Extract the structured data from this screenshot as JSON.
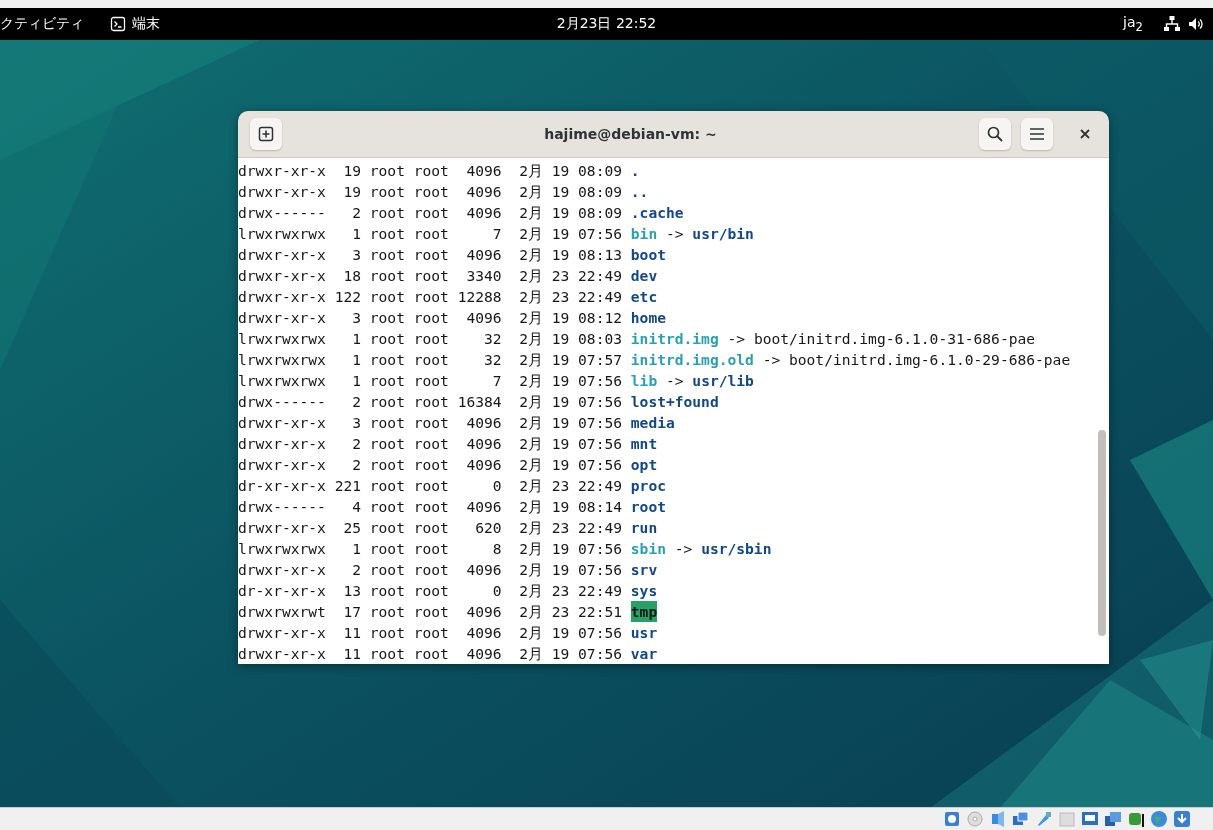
{
  "top_bar": {
    "activities": "クティビティ",
    "app_menu": "端末",
    "clock": "2月23日 22:52",
    "input_method": "ja$_{2}$"
  },
  "window": {
    "title": "hajime@debian-vm: ~"
  },
  "terminal": {
    "lines": [
      {
        "info": "drwxr-xr-x  19 root root  4096  2月 19 08:09",
        "name": ".",
        "kind": "dir"
      },
      {
        "info": "drwxr-xr-x  19 root root  4096  2月 19 08:09",
        "name": "..",
        "kind": "dir"
      },
      {
        "info": "drwx------   2 root root  4096  2月 19 08:09",
        "name": ".cache",
        "kind": "dir"
      },
      {
        "info": "lrwxrwxrwx   1 root root     7  2月 19 07:56",
        "name": "bin",
        "kind": "link",
        "arrow": "->",
        "target": {
          "text": "usr/bin",
          "kind": "dir"
        }
      },
      {
        "info": "drwxr-xr-x   3 root root  4096  2月 19 08:13",
        "name": "boot",
        "kind": "dir"
      },
      {
        "info": "drwxr-xr-x  18 root root  3340  2月 23 22:49",
        "name": "dev",
        "kind": "dir"
      },
      {
        "info": "drwxr-xr-x 122 root root 12288  2月 23 22:49",
        "name": "etc",
        "kind": "dir"
      },
      {
        "info": "drwxr-xr-x   3 root root  4096  2月 19 08:12",
        "name": "home",
        "kind": "dir"
      },
      {
        "info": "lrwxrwxrwx   1 root root    32  2月 19 08:03",
        "name": "initrd.img",
        "kind": "link",
        "arrow": "->",
        "target": {
          "text": "boot/initrd.img-6.1.0-31-686-pae",
          "kind": "file"
        }
      },
      {
        "info": "lrwxrwxrwx   1 root root    32  2月 19 07:57",
        "name": "initrd.img.old",
        "kind": "link",
        "arrow": "->",
        "target": {
          "text": "boot/initrd.img-6.1.0-29-686-pae",
          "kind": "file"
        }
      },
      {
        "info": "lrwxrwxrwx   1 root root     7  2月 19 07:56",
        "name": "lib",
        "kind": "link",
        "arrow": "->",
        "target": {
          "text": "usr/lib",
          "kind": "dir"
        }
      },
      {
        "info": "drwx------   2 root root 16384  2月 19 07:56",
        "name": "lost+found",
        "kind": "dir"
      },
      {
        "info": "drwxr-xr-x   3 root root  4096  2月 19 07:56",
        "name": "media",
        "kind": "dir"
      },
      {
        "info": "drwxr-xr-x   2 root root  4096  2月 19 07:56",
        "name": "mnt",
        "kind": "dir"
      },
      {
        "info": "drwxr-xr-x   2 root root  4096  2月 19 07:56",
        "name": "opt",
        "kind": "dir"
      },
      {
        "info": "dr-xr-xr-x 221 root root     0  2月 23 22:49",
        "name": "proc",
        "kind": "dir"
      },
      {
        "info": "drwx------   4 root root  4096  2月 19 08:14",
        "name": "root",
        "kind": "dir"
      },
      {
        "info": "drwxr-xr-x  25 root root   620  2月 23 22:49",
        "name": "run",
        "kind": "dir"
      },
      {
        "info": "lrwxrwxrwx   1 root root     8  2月 19 07:56",
        "name": "sbin",
        "kind": "link",
        "arrow": "->",
        "target": {
          "text": "usr/sbin",
          "kind": "dir"
        }
      },
      {
        "info": "drwxr-xr-x   2 root root  4096  2月 19 07:56",
        "name": "srv",
        "kind": "dir"
      },
      {
        "info": "dr-xr-xr-x  13 root root     0  2月 23 22:49",
        "name": "sys",
        "kind": "dir"
      },
      {
        "info": "drwxrwxrwt  17 root root  4096  2月 23 22:51",
        "name": "tmp",
        "kind": "sticky"
      },
      {
        "info": "drwxr-xr-x  11 root root  4096  2月 19 07:56",
        "name": "usr",
        "kind": "dir"
      },
      {
        "info": "drwxr-xr-x  11 root root  4096  2月 19 07:56",
        "name": "var",
        "kind": "dir"
      }
    ]
  }
}
